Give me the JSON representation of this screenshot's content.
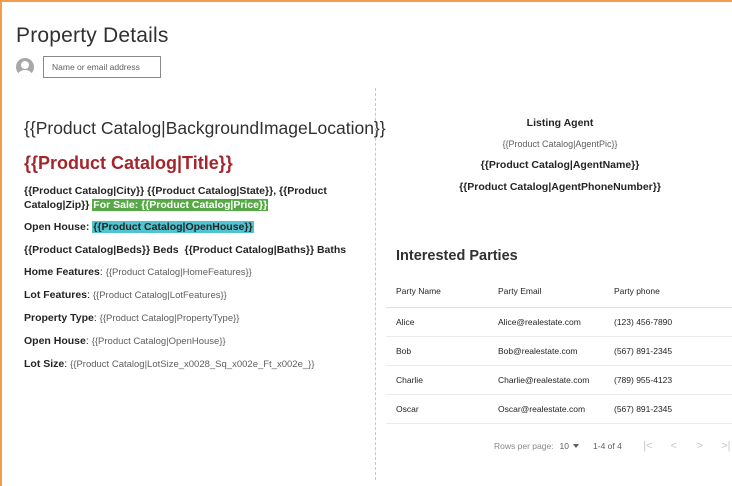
{
  "page_title": "Property Details",
  "people_picker": {
    "placeholder": "Name or email address",
    "avatar_icon": "person-avatar-icon"
  },
  "listing": {
    "background_image": "{{Product Catalog|BackgroundImageLocation}}",
    "title": "{{Product Catalog|Title}}",
    "city": "{{Product Catalog|City}}",
    "state": "{{Product Catalog|State}}",
    "zip_prefix": "{{Product",
    "zip_suffix": "Catalog|Zip}}",
    "for_sale": "For Sale: {{Product Catalog|Price}}",
    "open_house_label": "Open House",
    "open_house_value": "{{Product Catalog|OpenHouse}}",
    "beds": "{{Product Catalog|Beds}}",
    "beds_label": "Beds",
    "baths": "{{Product Catalog|Baths}}",
    "baths_label": "Baths",
    "fields": [
      {
        "label": "Home Features",
        "value": "{{Product Catalog|HomeFeatures}}"
      },
      {
        "label": "Lot Features",
        "value": "{{Product Catalog|LotFeatures}}"
      },
      {
        "label": "Property Type",
        "value": "{{Product Catalog|PropertyType}}"
      },
      {
        "label": "Open House",
        "value": "{{Product Catalog|OpenHouse}}"
      },
      {
        "label": "Lot Size",
        "value": "{{Product Catalog|LotSize_x0028_Sq_x002e_Ft_x002e_}}"
      }
    ]
  },
  "agent": {
    "heading": "Listing Agent",
    "pic": "{{Product Catalog|AgentPic}}",
    "name": "{{Product Catalog|AgentName}}",
    "phone": "{{Product Catalog|AgentPhoneNumber}}"
  },
  "interested_parties": {
    "title": "Interested Parties",
    "columns": [
      "Party Name",
      "Party Email",
      "Party phone"
    ],
    "rows": [
      [
        "Alice",
        "Alice@realestate.com",
        "(123) 456-7890"
      ],
      [
        "Bob",
        "Bob@realestate.com",
        "(567) 891-2345"
      ],
      [
        "Charlie",
        "Charlie@realestate.com",
        "(789) 955-4123"
      ],
      [
        "Oscar",
        "Oscar@realestate.com",
        "(567) 891-2345"
      ]
    ],
    "pager": {
      "rows_per_page_label": "Rows per page:",
      "rows_per_page_value": "10",
      "range": "1-4 of 4",
      "first": "|<",
      "prev": "<",
      "next": ">",
      "last": ">|"
    }
  },
  "colors": {
    "accent_border": "#f39c4a",
    "title_red": "#a4262c",
    "highlight_green": "#57a846",
    "highlight_teal": "#4fc3d0"
  }
}
